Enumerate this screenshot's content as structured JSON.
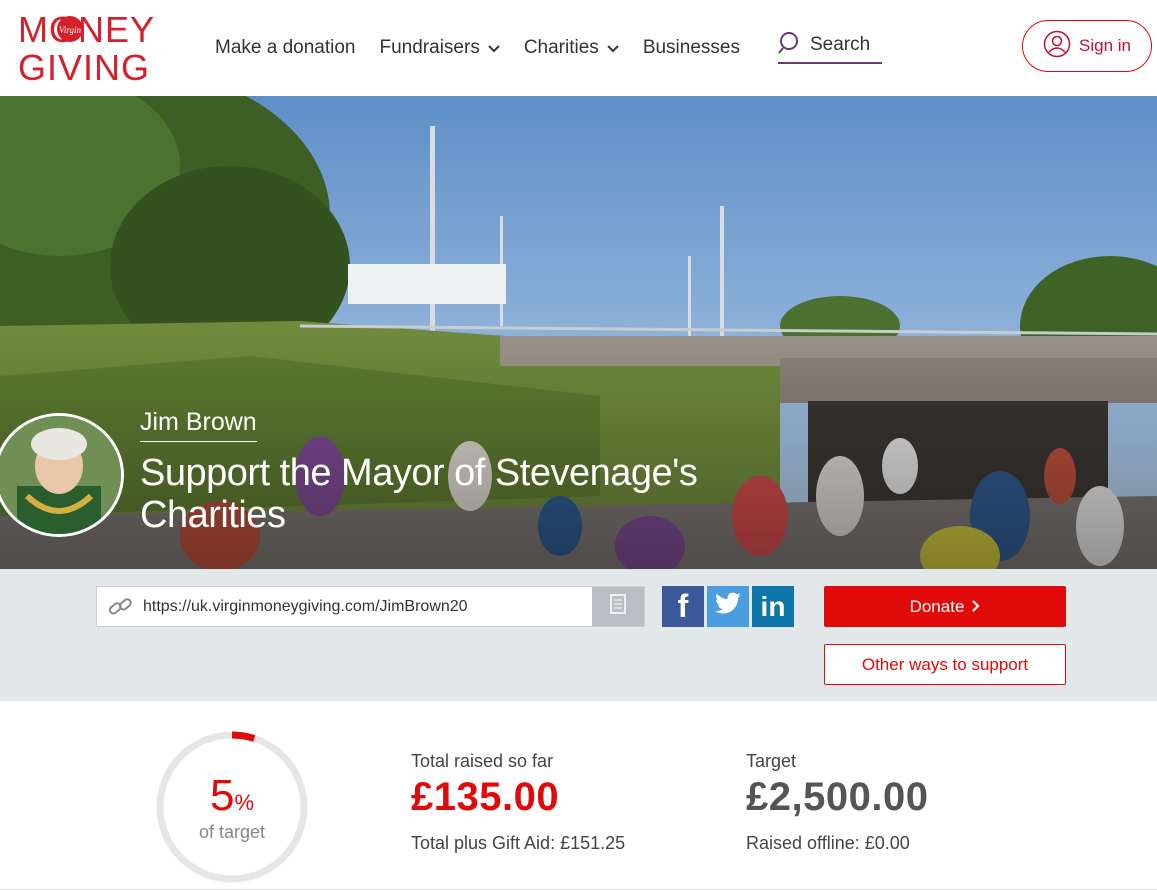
{
  "brand": {
    "logo_line1": "MONEY",
    "logo_line2": "GIVING",
    "logo_badge": "Virgin",
    "accent": "#e10a0a",
    "purple": "#6b3a6e"
  },
  "nav": {
    "items": [
      {
        "label": "Make a donation",
        "dropdown": false
      },
      {
        "label": "Fundraisers",
        "dropdown": true
      },
      {
        "label": "Charities",
        "dropdown": true
      },
      {
        "label": "Businesses",
        "dropdown": false
      }
    ],
    "search_label": "Search",
    "signin_label": "Sign in"
  },
  "hero": {
    "fundraiser_name": "Jim Brown",
    "title": "Support the Mayor of Stevenage's Charities"
  },
  "share": {
    "url": "https://uk.virginmoneygiving.com/JimBrown20",
    "facebook_label": "f",
    "twitter_icon": "twitter-bird-icon",
    "linkedin_label": "in",
    "donate_label": "Donate",
    "other_label": "Other ways to support"
  },
  "stats": {
    "percent": "5",
    "percent_symbol": "%",
    "percent_value": 0.05,
    "percent_caption": "of target",
    "raised_label": "Total raised so far",
    "raised_amount": "£135.00",
    "gift_aid": "Total plus Gift Aid: £151.25",
    "target_label": "Target",
    "target_amount": "£2,500.00",
    "offline": "Raised offline: £0.00"
  }
}
